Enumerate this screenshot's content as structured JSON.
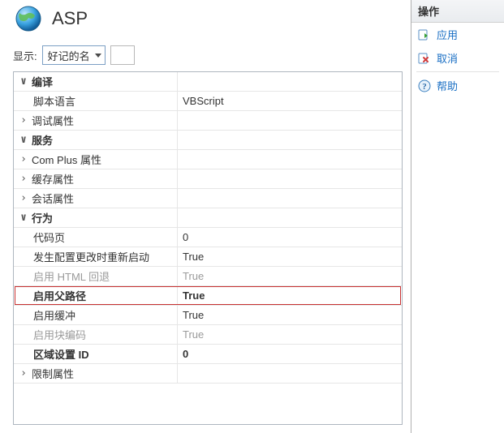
{
  "title": "ASP",
  "filter": {
    "label": "显示:",
    "selected": "好记的名"
  },
  "grid": {
    "cat_compile": "编译",
    "compile_lang_label": "脚本语言",
    "compile_lang_value": "VBScript",
    "compile_debug_label": "调试属性",
    "cat_services": "服务",
    "svc_complus_label": "Com Plus 属性",
    "svc_cache_label": "缓存属性",
    "svc_session_label": "会话属性",
    "cat_behavior": "行为",
    "bh_codepage_label": "代码页",
    "bh_codepage_value": "0",
    "bh_restart_label": "发生配置更改时重新启动",
    "bh_restart_value": "True",
    "bh_htmlfallback_label": "启用 HTML 回退",
    "bh_htmlfallback_value": "True",
    "bh_parent_label": "启用父路径",
    "bh_parent_value": "True",
    "bh_buffer_label": "启用缓冲",
    "bh_buffer_value": "True",
    "bh_chunked_label": "启用块编码",
    "bh_chunked_value": "True",
    "bh_locale_label": "区域设置 ID",
    "bh_locale_value": "0",
    "bh_limits_label": "限制属性"
  },
  "actions": {
    "header": "操作",
    "apply": "应用",
    "cancel": "取消",
    "help": "帮助"
  }
}
